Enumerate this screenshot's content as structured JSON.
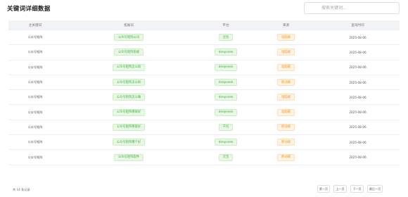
{
  "page": {
    "title": "关键词详细数据"
  },
  "search": {
    "placeholder": "搜索关键词..."
  },
  "table": {
    "columns": [
      "主关键词",
      "拓展词",
      "平台",
      "来源",
      "查询时间"
    ],
    "rows": [
      {
        "main": "公众号矩阵",
        "expand": "公众号矩阵公司",
        "platform": "豆包",
        "source": "电脑端",
        "time": "2025-08-06"
      },
      {
        "main": "公众号矩阵",
        "expand": "公众号矩阵系统",
        "platform": "deepseek",
        "source": "电脑端",
        "time": "2025-08-06"
      },
      {
        "main": "公众号矩阵",
        "expand": "公众号矩阵怎么样",
        "platform": "deepseek",
        "source": "电脑端",
        "time": "2025-08-06"
      },
      {
        "main": "公众号矩阵",
        "expand": "公众号矩阵怎么样",
        "platform": "deepseek",
        "source": "移动端",
        "time": "2025-08-06"
      },
      {
        "main": "公众号矩阵",
        "expand": "公众号矩阵怎么做",
        "platform": "deepseek",
        "source": "电脑端",
        "time": "2025-08-06"
      },
      {
        "main": "公众号矩阵",
        "expand": "公众号矩阵哪家好",
        "platform": "deepseek",
        "source": "电脑端",
        "time": "2025-08-06"
      },
      {
        "main": "公众号矩阵",
        "expand": "公众号矩阵哪家好",
        "platform": "千问",
        "source": "移动端",
        "time": "2025-08-06"
      },
      {
        "main": "公众号矩阵",
        "expand": "公众号矩阵哪个好",
        "platform": "deepseek",
        "source": "移动端",
        "time": "2025-08-06"
      },
      {
        "main": "公众号矩阵",
        "expand": "公众号矩阵软件",
        "platform": "元宝",
        "source": "移动端",
        "time": "2025-08-06"
      }
    ]
  },
  "footer": {
    "total": "共 14 条记录"
  },
  "pagination": {
    "first": "第一页",
    "prev": "上一页",
    "next": "下一页",
    "last": "最后一页"
  },
  "colors": {
    "tag_green": "#3fb23a",
    "tag_orange": "#f09a27",
    "header_bg": "#f2f3f5"
  }
}
